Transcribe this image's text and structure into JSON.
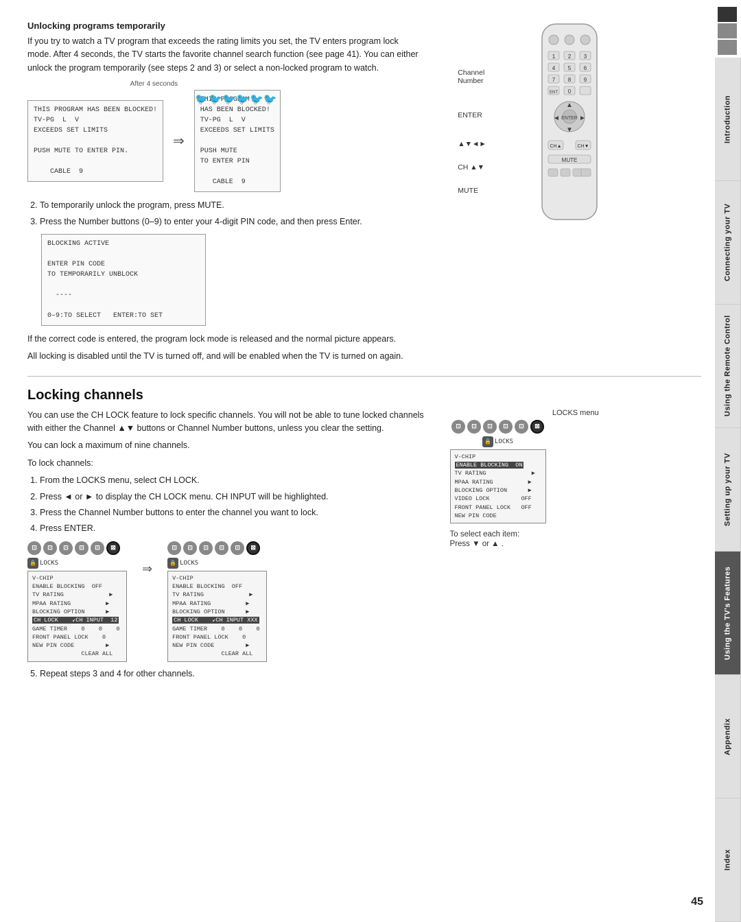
{
  "sidebar": {
    "blocks": [
      "dark",
      "dark",
      "light"
    ],
    "tabs": [
      {
        "label": "Introduction",
        "active": false
      },
      {
        "label": "Connecting your TV",
        "active": false
      },
      {
        "label": "Using the Remote Control",
        "active": false
      },
      {
        "label": "Setting up your TV",
        "active": false
      },
      {
        "label": "Using the TV's Features",
        "active": true
      },
      {
        "label": "Appendix",
        "active": false
      },
      {
        "label": "Index",
        "active": false
      }
    ]
  },
  "page_number": "45",
  "section1": {
    "heading": "Unlocking programs temporarily",
    "para1": "If you try to watch a TV program that exceeds the rating limits you set, the TV enters program lock mode. After 4 seconds, the TV starts the favorite channel search function (see page 41). You can either unlock the program temporarily (see steps 2 and 3) or select a non-locked program to watch.",
    "after4seconds_label": "After 4 seconds",
    "screen1_lines": [
      "THIS PROGRAM HAS BEEN BLOCKED!",
      "TV-PG  L  V",
      "EXCEEDS SET LIMITS",
      "",
      "PUSH MUTE TO ENTER PIN.",
      "",
      "CABLE  9"
    ],
    "screen2_lines": [
      "THIS PROGRAM",
      "HAS BEEN BLOCKED!",
      "TV-PG  L  V",
      "EXCEEDS SET LIMITS",
      "",
      "PUSH MUTE",
      "TO ENTER PIN",
      "",
      "CABLE  9"
    ],
    "step2": "To temporarily unlock the program, press MUTE.",
    "step3": "Press the Number buttons (0–9) to enter your 4-digit PIN code, and then press Enter.",
    "blocking_screen_lines": [
      "BLOCKING ACTIVE",
      "",
      "ENTER PIN CODE",
      "TO TEMPORARILY UNBLOCK",
      "",
      "----",
      "",
      "0–9:TO SELECT  ENTER:TO SET"
    ],
    "para2": "If the correct code is entered, the program lock mode is released and the normal picture appears.",
    "para3": "All locking is disabled until the TV is turned off, and will be enabled when the TV is turned on again."
  },
  "section2": {
    "heading": "Locking channels",
    "para1": "You can use the CH LOCK feature to lock specific channels. You will not be able to tune locked channels with either the Channel ▲▼ buttons or Channel Number buttons, unless you clear the setting.",
    "para2": "You can lock a maximum of nine channels.",
    "to_lock_label": "To lock channels:",
    "steps": [
      "From the LOCKS menu, select CH LOCK.",
      "Press ◄ or ► to display the CH LOCK menu. CH INPUT will be highlighted.",
      "Press the Channel Number buttons to enter the channel you want to lock.",
      "Press ENTER."
    ],
    "step5": "Repeat steps 3 and 4 for other channels.",
    "locks_menu_label": "LOCKS menu",
    "to_select_label": "To select each item:",
    "press_label": "Press",
    "press_symbol": "▼ or ▲ .",
    "menu1_lines": [
      "V-CHIP",
      "ENABLE BLOCKING  OFF",
      "TV RATING              ▶",
      "MPAA RATING            ▶",
      "BLOCKING OPTION        ▶",
      "CH LOCK      ↙CH INPUT  12",
      "GAME TIMER   0    0    0",
      "FRONT PANEL LOCK    OFF",
      "NEW PIN CODE           ▶",
      "              CLEAR ALL"
    ],
    "menu2_lines": [
      "V-CHIP",
      "ENABLE BLOCKING  OFF",
      "TV RATING              ▶",
      "MPAA RATING            ▶",
      "BLOCKING OPTION        ▶",
      "CH LOCK      ↙CH INPUT  XXX",
      "GAME TIMER   0    0    0",
      "FRONT PANEL LOCK    OFF",
      "NEW PIN CODE           ▶",
      "              CLEAR ALL"
    ],
    "remote_labels": {
      "channel_number": "Channel Number",
      "enter": "ENTER",
      "arrows": "▲▼◄►",
      "ch": "CH ▲▼",
      "mute": "MUTE"
    }
  }
}
